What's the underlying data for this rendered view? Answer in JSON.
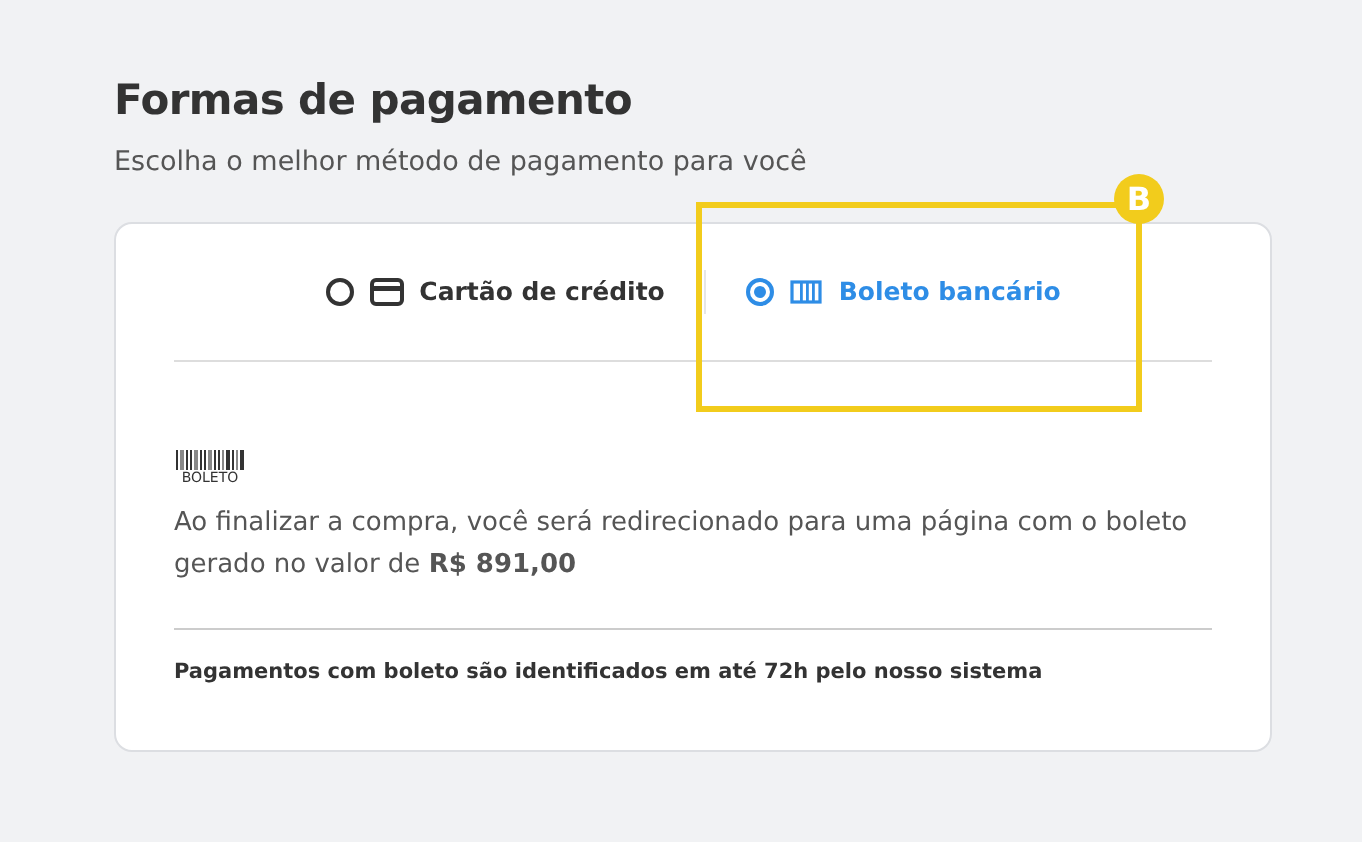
{
  "title": "Formas de pagamento",
  "subtitle": "Escolha o melhor método de pagamento para você",
  "tabs": [
    {
      "kind": "card",
      "label": "Cartão de crédito",
      "selected": false
    },
    {
      "kind": "boleto",
      "label": "Boleto bancário",
      "selected": true
    }
  ],
  "boleto_logo": {
    "label": "BOLETO"
  },
  "message": "Ao finalizar a compra, você será redirecionado para uma página com o boleto gerado no valor de **R$ 891,00**",
  "note": "Pagamentos com boleto são identificados em até 72h pelo nosso sistema",
  "annotation": {
    "label": "B"
  }
}
